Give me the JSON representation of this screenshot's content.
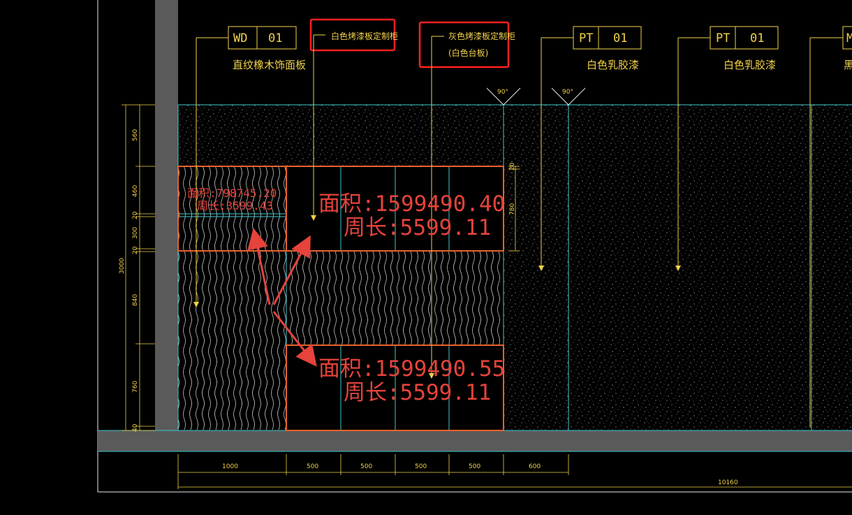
{
  "colors": {
    "background": "#000000",
    "wall_gray": "#5a5a5a",
    "cyan_line": "#3fc7d1",
    "yellow_annotation": "#f2d24a",
    "red_markup": "#e5433b",
    "orange_outline": "#e8622c",
    "highlight_box": "#ff2020"
  },
  "tags": {
    "wd01": {
      "code": "WD",
      "num": "01",
      "label": "直纹橡木饰面板"
    },
    "white_cabinet": {
      "label": "白色烤漆板定制柜"
    },
    "gray_cabinet": {
      "label": "灰色烤漆板定制柜",
      "sub": "(白色台板)"
    },
    "pt01_a": {
      "code": "PT",
      "num": "01",
      "label": "白色乳胶漆"
    },
    "pt01_b": {
      "code": "PT",
      "num": "01",
      "label": "白色乳胶漆"
    },
    "m_cut": {
      "code": "M",
      "label": "黑"
    }
  },
  "angles": {
    "a1": "90°",
    "a2": "90°"
  },
  "measures": {
    "small": {
      "area": "面积:798745.20",
      "perim": "周长:3599.43"
    },
    "upper": {
      "area": "面积:1599490.40",
      "perim": "周长:5599.11"
    },
    "lower": {
      "area": "面积:1599490.55",
      "perim": "周长:5599.11"
    }
  },
  "left_dims": {
    "d560": "560",
    "d460": "460",
    "d20a": "20",
    "d300": "300",
    "d20b": "20",
    "d840": "840",
    "d760": "760",
    "d40": "40",
    "total": "3000"
  },
  "right_dims": {
    "d20": "20",
    "d780": "780"
  },
  "bottom_dims": {
    "d1000": "1000",
    "d500a": "500",
    "d500b": "500",
    "d500c": "500",
    "d500d": "500",
    "d600": "600",
    "total": "10160"
  }
}
